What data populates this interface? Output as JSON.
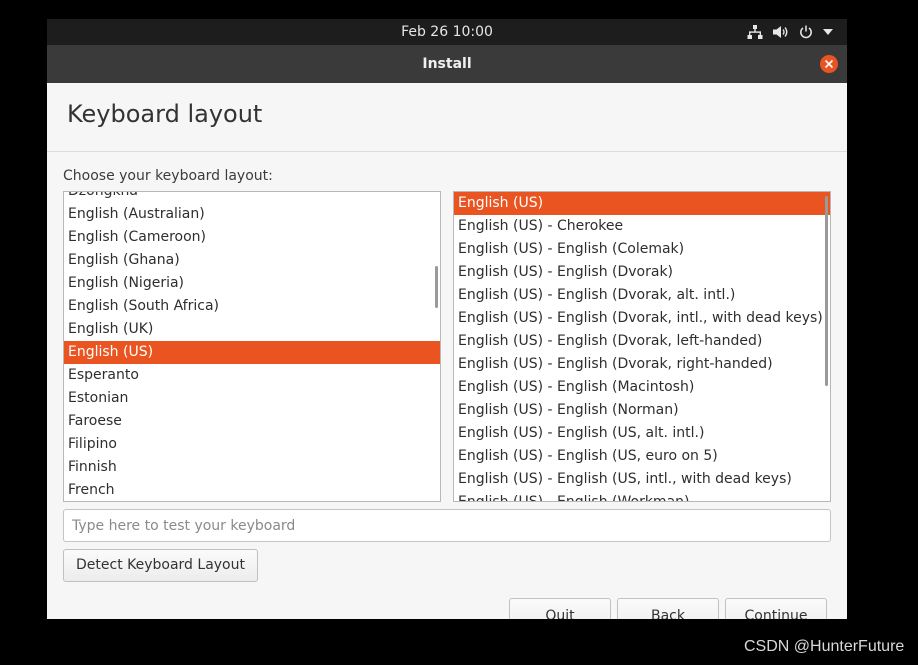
{
  "topbar": {
    "datetime": "Feb 26  10:00",
    "icons": [
      "network-icon",
      "volume-icon",
      "power-icon",
      "chevron-down-icon"
    ]
  },
  "window": {
    "title": "Install"
  },
  "page": {
    "title": "Keyboard layout",
    "choose_label": "Choose your keyboard layout:"
  },
  "layouts": {
    "items": [
      "Dzongkha",
      "English (Australian)",
      "English (Cameroon)",
      "English (Ghana)",
      "English (Nigeria)",
      "English (South Africa)",
      "English (UK)",
      "English (US)",
      "Esperanto",
      "Estonian",
      "Faroese",
      "Filipino",
      "Finnish",
      "French"
    ],
    "selected": "English (US)"
  },
  "variants": {
    "items": [
      "English (US)",
      "English (US) - Cherokee",
      "English (US) - English (Colemak)",
      "English (US) - English (Dvorak)",
      "English (US) - English (Dvorak, alt. intl.)",
      "English (US) - English (Dvorak, intl., with dead keys)",
      "English (US) - English (Dvorak, left-handed)",
      "English (US) - English (Dvorak, right-handed)",
      "English (US) - English (Macintosh)",
      "English (US) - English (Norman)",
      "English (US) - English (US, alt. intl.)",
      "English (US) - English (US, euro on 5)",
      "English (US) - English (US, intl., with dead keys)",
      "English (US) - English (Workman)"
    ],
    "selected": "English (US)"
  },
  "test_field": {
    "placeholder": "Type here to test your keyboard",
    "value": ""
  },
  "buttons": {
    "detect": "Detect Keyboard Layout",
    "quit": "Quit",
    "back": "Back",
    "continue": "Continue"
  },
  "watermark": "CSDN @HunterFuture",
  "colors": {
    "accent": "#e95420",
    "topbar": "#1d1d1d",
    "titlebar": "#3a3a3a"
  }
}
